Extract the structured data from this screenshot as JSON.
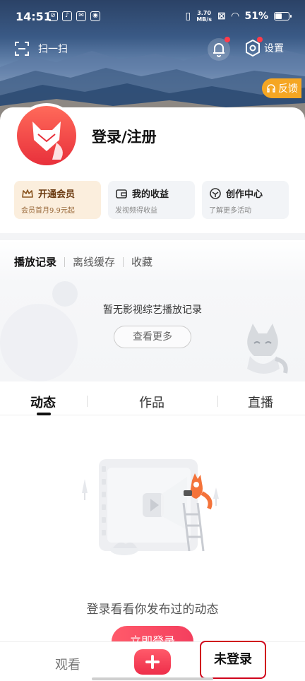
{
  "status_bar": {
    "time": "14:51",
    "speed_value": "3.70",
    "speed_unit": "MB/s",
    "battery": "51%",
    "battery_level": 0.51
  },
  "header": {
    "scan_label": "扫一扫",
    "settings_label": "设置",
    "feedback_label": "反馈"
  },
  "profile": {
    "login_label": "登录/注册"
  },
  "tiles": [
    {
      "title": "开通会员",
      "subtitle": "会员首月9.9元起",
      "icon": "crown-icon"
    },
    {
      "title": "我的收益",
      "subtitle": "发视频得收益",
      "icon": "wallet-icon"
    },
    {
      "title": "创作中心",
      "subtitle": "了解更多活动",
      "icon": "creator-icon"
    }
  ],
  "history": {
    "tabs": [
      "播放记录",
      "离线缓存",
      "收藏"
    ],
    "empty_text": "暂无影视综艺播放记录",
    "more_button": "查看更多"
  },
  "content_tabs": [
    "动态",
    "作品",
    "直播"
  ],
  "empty_state": {
    "prompt": "登录看看你发布过的动态",
    "cta": "立即登录"
  },
  "bottom_nav": {
    "watch": "观看",
    "me": "未登录"
  },
  "colors": {
    "accent": "#f43f5e",
    "highlight_box": "#d0021b",
    "feedback": "#f5a623"
  }
}
